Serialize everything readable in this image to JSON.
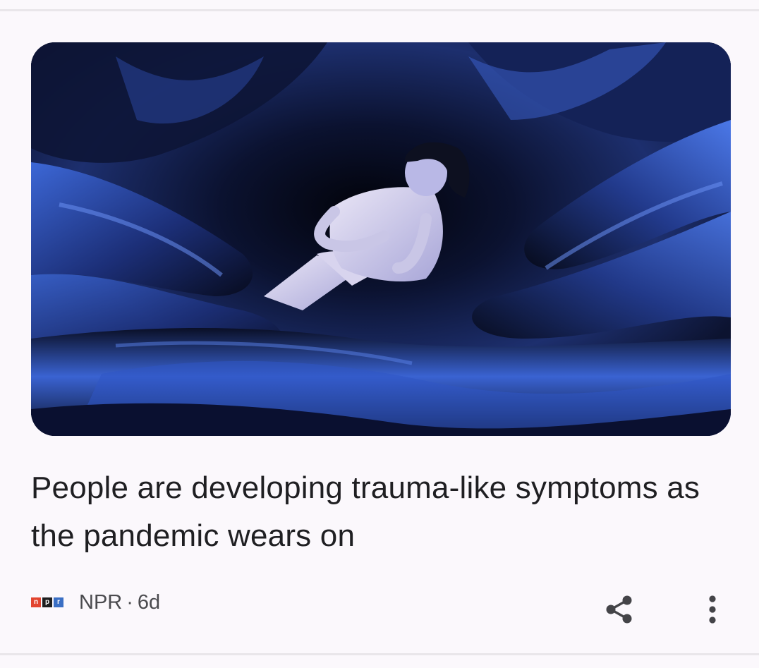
{
  "card": {
    "image_alt": "Illustration of a woman lying on dark blue billowing fabric",
    "headline": "People are developing trauma-like symptoms as the pandemic wears on",
    "source_logo_letters": [
      "n",
      "p",
      "r"
    ],
    "source_logo_colors": [
      "#e2442f",
      "#1e1e1e",
      "#3a6fc4"
    ],
    "source": "NPR",
    "separator": "·",
    "age": "6d",
    "share_icon": "share-icon",
    "more_icon": "more-vert-icon"
  },
  "colors": {
    "background": "#fbf8fc",
    "headline_text": "#1f1f22",
    "meta_text": "#4a4a4e",
    "icon": "#444448",
    "divider": "#e9e6ea"
  }
}
